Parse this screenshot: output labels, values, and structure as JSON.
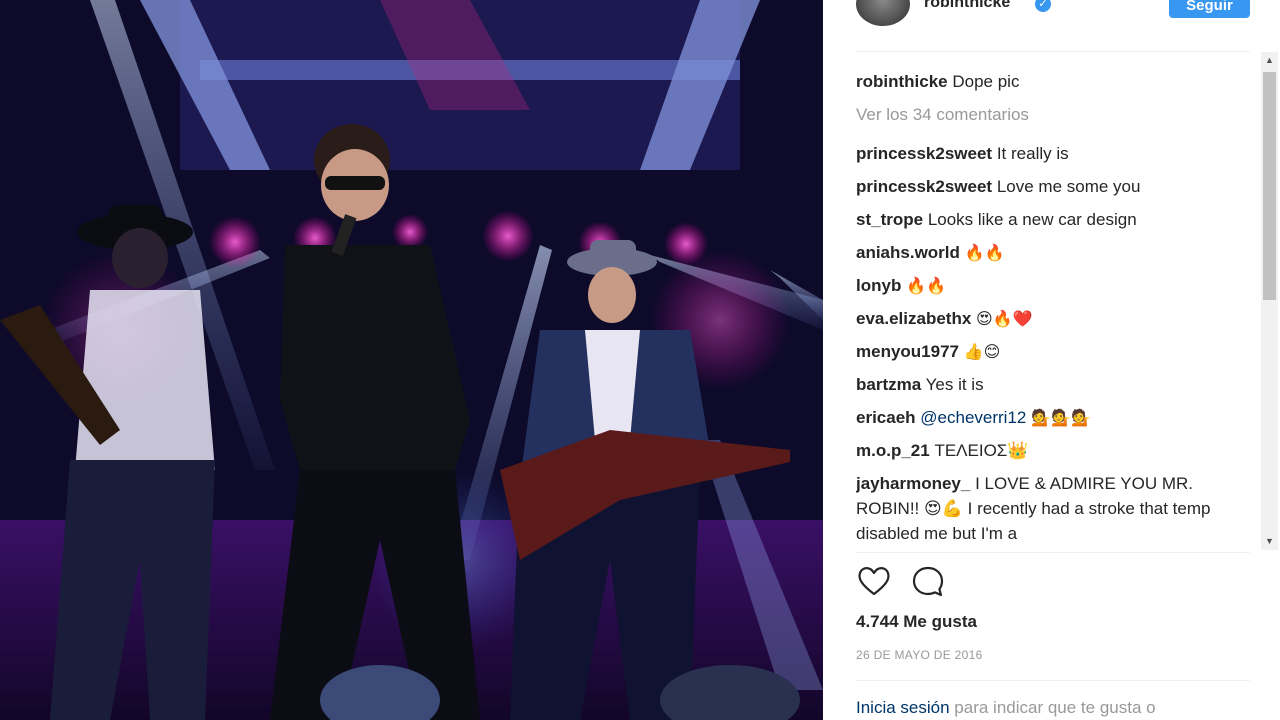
{
  "header": {
    "username": "robinthicke",
    "verified_icon": "verified-check-icon",
    "follow_label": "Seguir"
  },
  "caption": {
    "user": "robinthicke",
    "text": "Dope pic"
  },
  "view_all_comments": "Ver los 34 comentarios",
  "comments": [
    {
      "user": "princessk2sweet",
      "text": "It really is"
    },
    {
      "user": "princessk2sweet",
      "text": "Love me some you"
    },
    {
      "user": "st_trope",
      "text": "Looks like a new car design"
    },
    {
      "user": "aniahs.world",
      "text": "🔥🔥"
    },
    {
      "user": "lonyb",
      "text": "🔥🔥"
    },
    {
      "user": "eva.elizabethx",
      "text": "😍🔥❤️"
    },
    {
      "user": "menyou1977",
      "text": "👍😊"
    },
    {
      "user": "bartzma",
      "text": "Yes it is"
    },
    {
      "user": "ericaeh",
      "mention": "@echeverri12",
      "text": "💁💁💁"
    },
    {
      "user": "m.o.p_21",
      "text": "ΤΕΛΕΙΟΣ👑"
    },
    {
      "user": "jayharmoney_",
      "text": "I LOVE & ADMIRE YOU MR. ROBIN!! 😍💪 I recently had a stroke that temp disabled me but I'm a"
    }
  ],
  "actions": {
    "like_icon": "heart-icon",
    "comment_icon": "comment-bubble-icon"
  },
  "likes": "4.744 Me gusta",
  "date": "26 DE MAYO DE 2016",
  "login_prompt": {
    "link": "Inicia sesión",
    "text": "para indicar que te gusta o"
  },
  "colors": {
    "accent": "#3897f0",
    "link": "#003569",
    "muted": "#999999",
    "text": "#262626"
  }
}
